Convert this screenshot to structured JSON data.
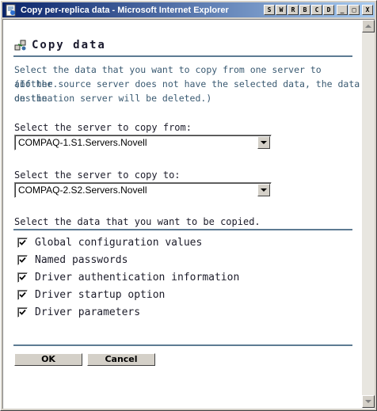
{
  "window": {
    "title": "Copy per-replica data - Microsoft Internet Explorer",
    "title_icon": "ie-page-icon",
    "buttons": [
      "S",
      "W",
      "R",
      "B",
      "C",
      "D"
    ],
    "minimize": "_",
    "maximize": "□",
    "close": "X"
  },
  "page": {
    "heading": "Copy data",
    "heading_icon": "copy-data-icon",
    "description_line1": "Select the data that you want to copy from one server to another.",
    "description_line2": "(If the source server does not have the selected data, the data on the",
    "description_line3": "destination server will be deleted.)",
    "from_label": "Select the server to copy from:",
    "from_value": "COMPAQ-1.S1.Servers.Novell",
    "to_label": "Select the server to copy to:",
    "to_value": "COMPAQ-2.S2.Servers.Novell",
    "data_label": "Select the data that you want to be copied.",
    "options": [
      {
        "label": "Global configuration values",
        "checked": true
      },
      {
        "label": "Named passwords",
        "checked": true
      },
      {
        "label": "Driver authentication information",
        "checked": true
      },
      {
        "label": "Driver startup option",
        "checked": true
      },
      {
        "label": "Driver parameters",
        "checked": true
      }
    ],
    "ok_label": "OK",
    "cancel_label": "Cancel"
  },
  "colors": {
    "titlebar_start": "#0a246a",
    "titlebar_end": "#a6caf0",
    "rule": "#5d7b93",
    "text": "#3a5a72"
  }
}
